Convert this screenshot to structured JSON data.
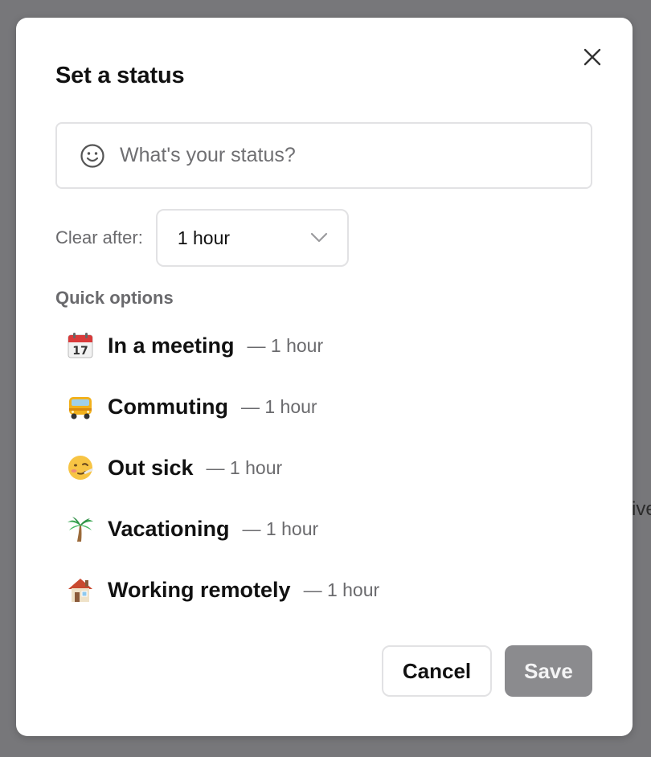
{
  "background": {
    "partial_text": "ive"
  },
  "modal": {
    "title": "Set a status",
    "close_icon": "close-icon",
    "status_input": {
      "placeholder": "What's your status?",
      "value": "",
      "icon": "smiley-icon"
    },
    "clear_after": {
      "label": "Clear after:",
      "selected": "1 hour",
      "icon": "chevron-down-icon"
    },
    "quick_options": {
      "heading": "Quick options",
      "items": [
        {
          "icon": "calendar-icon",
          "label": "In a meeting",
          "duration": "— 1 hour"
        },
        {
          "icon": "bus-icon",
          "label": "Commuting",
          "duration": "— 1 hour"
        },
        {
          "icon": "sick-face-icon",
          "label": "Out sick",
          "duration": "— 1 hour"
        },
        {
          "icon": "palm-tree-icon",
          "label": "Vacationing",
          "duration": "— 1 hour"
        },
        {
          "icon": "house-icon",
          "label": "Working remotely",
          "duration": "— 1 hour"
        }
      ]
    },
    "buttons": {
      "cancel": "Cancel",
      "save": "Save"
    }
  },
  "colors": {
    "overlay": "#77777a",
    "save_disabled": "#8b8b8e",
    "border": "#e2e2e4",
    "muted_text": "#6a6a6d"
  }
}
